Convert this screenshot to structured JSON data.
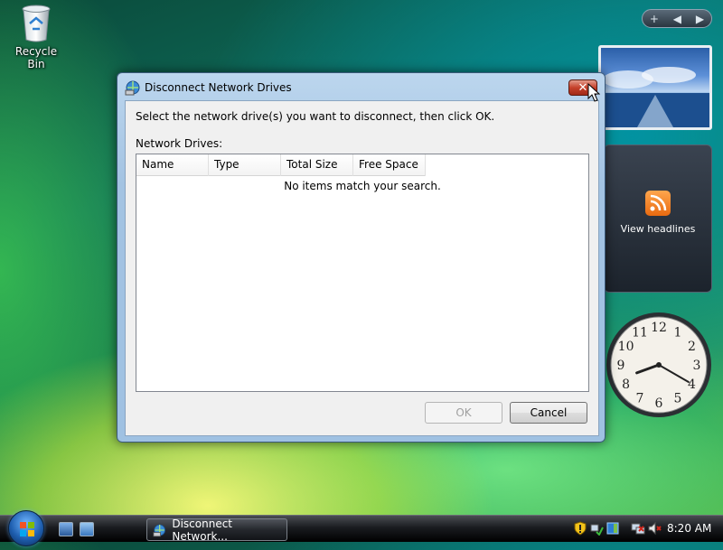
{
  "desktop": {
    "icons": [
      {
        "label": "Recycle Bin",
        "icon": "recycle-bin-icon"
      }
    ]
  },
  "sidebar": {
    "controls": [
      "+",
      "◀",
      "▶"
    ],
    "feed_gadget": {
      "label": "View headlines",
      "icon": "rss-icon",
      "color": "#f07d20"
    },
    "clock_gadget": {
      "numbers": [
        "12",
        "1",
        "2",
        "3",
        "4",
        "5",
        "6",
        "7",
        "8",
        "9",
        "10",
        "11"
      ],
      "hour": 8,
      "minute": 20
    }
  },
  "dialog": {
    "title": "Disconnect Network Drives",
    "close_label": "✕",
    "instruction": "Select the network drive(s) you want to disconnect, then click OK.",
    "list_label": "Network Drives:",
    "columns": [
      "Name",
      "Type",
      "Total Size",
      "Free Space"
    ],
    "empty_message": "No items match your search.",
    "ok_label": "OK",
    "ok_enabled": false,
    "cancel_label": "Cancel"
  },
  "taskbar": {
    "task_button": "Disconnect Network...",
    "clock": "8:20 AM",
    "tray_icons": [
      "shield-icon",
      "network-icon",
      "sidebar-icon",
      "network-disconnected-icon",
      "volume-muted-icon"
    ]
  },
  "colors": {
    "accent": "#1f5fb0",
    "close_button": "#c5412b"
  }
}
